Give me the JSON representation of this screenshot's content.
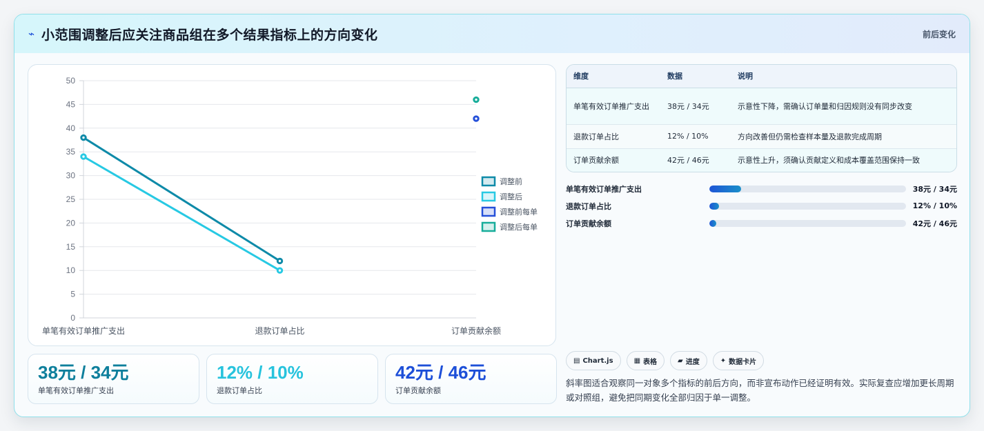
{
  "header": {
    "icon": "sparkline-icon",
    "title": "小范围调整后应关注商品组在多个结果指标上的方向变化",
    "tag": "前后变化"
  },
  "chart_data": {
    "type": "line",
    "categories": [
      "单笔有效订单推广支出",
      "退款订单占比",
      "订单贡献余额"
    ],
    "ylim": [
      0,
      50
    ],
    "yticks": [
      0,
      5,
      10,
      15,
      20,
      25,
      30,
      35,
      40,
      45,
      50
    ],
    "grid": true,
    "legend_placement": "right",
    "series": [
      {
        "name": "调整前",
        "values": [
          38,
          12,
          null
        ],
        "color": "#0e8aa8",
        "kind": "line"
      },
      {
        "name": "调整后",
        "values": [
          34,
          10,
          null
        ],
        "color": "#27c9e3",
        "kind": "line"
      },
      {
        "name": "调整前每单",
        "values": [
          null,
          null,
          42
        ],
        "color": "#2550d9",
        "kind": "point"
      },
      {
        "name": "调整后每单",
        "values": [
          null,
          null,
          46
        ],
        "color": "#17ad9a",
        "kind": "point"
      }
    ]
  },
  "stats": [
    {
      "value": "38元 / 34元",
      "label": "单笔有效订单推广支出",
      "color": "#0e7f9c"
    },
    {
      "value": "12% / 10%",
      "label": "退款订单占比",
      "color": "#27c3dd"
    },
    {
      "value": "42元 / 46元",
      "label": "订单贡献余额",
      "color": "#1d4fd8"
    }
  ],
  "table": {
    "headers": [
      "维度",
      "数据",
      "说明"
    ],
    "rows": [
      [
        "单笔有效订单推广支出",
        "38元 / 34元",
        "示意性下降，需确认订单量和归因规则没有同步改变"
      ],
      [
        "退款订单占比",
        "12% / 10%",
        "方向改善但仍需检查样本量及退款完成周期"
      ],
      [
        "订单贡献余额",
        "42元 / 46元",
        "示意性上升，须确认贡献定义和成本覆盖范围保持一致"
      ]
    ]
  },
  "progress": [
    {
      "label": "单笔有效订单推广支出",
      "value": "38元 / 34元",
      "fraction": 0.16
    },
    {
      "label": "退款订单占比",
      "value": "12% / 10%",
      "fraction": 0.05
    },
    {
      "label": "订单贡献余额",
      "value": "42元 / 46元",
      "fraction": 0.035
    }
  ],
  "pills": [
    {
      "icon": "chart-icon",
      "glyph": "▤",
      "label": "Chart.js"
    },
    {
      "icon": "table-icon",
      "glyph": "▦",
      "label": "表格"
    },
    {
      "icon": "progress-icon",
      "glyph": "▰",
      "label": "进度"
    },
    {
      "icon": "card-icon",
      "glyph": "✦",
      "label": "数据卡片"
    }
  ],
  "note": "斜率图适合观察同一对象多个指标的前后方向，而非宣布动作已经证明有效。实际复查应增加更长周期或对照组，避免把同期变化全部归因于单一调整。"
}
